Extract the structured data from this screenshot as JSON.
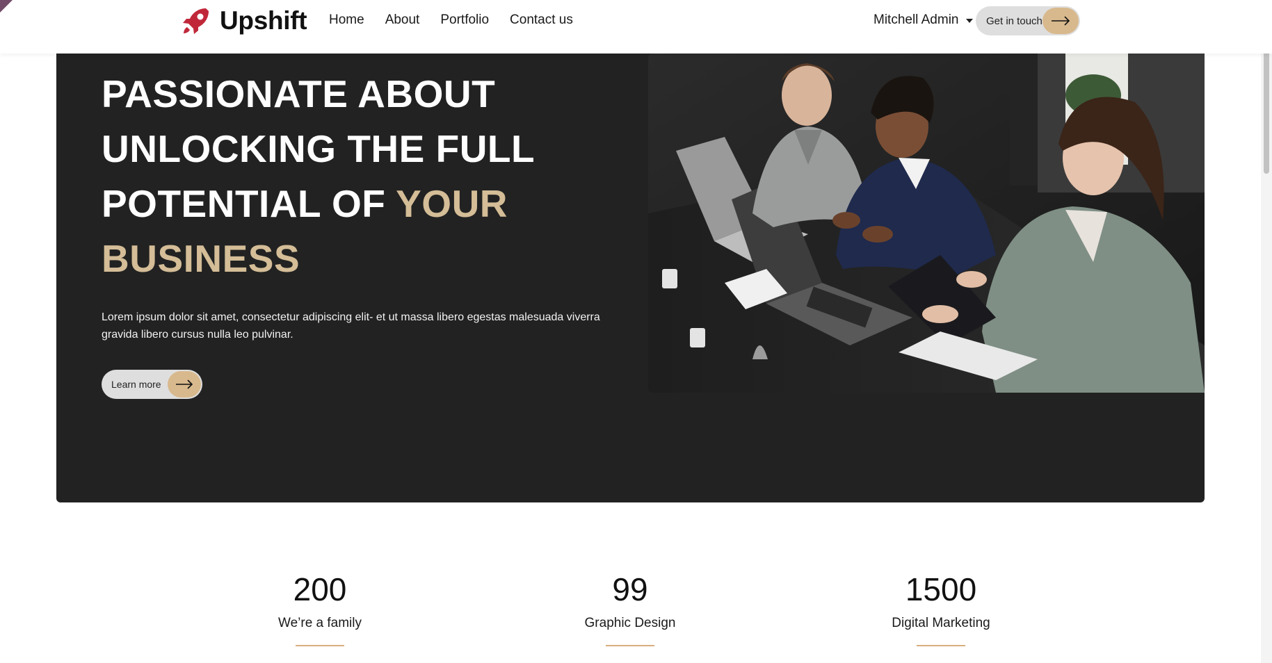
{
  "header": {
    "brand_name": "Upshift",
    "nav": [
      "Home",
      "About",
      "Portfolio",
      "Contact us"
    ],
    "user_name": "Mitchell Admin",
    "cta_label": "Get in touch"
  },
  "hero": {
    "title_line1": "PASSIONATE ABOUT",
    "title_line2": "UNLOCKING THE FULL",
    "title_line3_white": "POTENTIAL OF",
    "title_line3_accent": "YOUR",
    "title_line4_accent": "BUSINESS",
    "body": "Lorem ipsum dolor sit amet, consectetur adipiscing elit- et ut massa libero egestas malesuada viverra gravida libero cursus nulla leo pulvinar.",
    "button_label": "Learn more",
    "image_subject": "office-meeting-photo"
  },
  "stats": [
    {
      "value": "200",
      "label": "We’re a family"
    },
    {
      "value": "99",
      "label": "Graphic Design"
    },
    {
      "value": "1500",
      "label": "Digital Marketing"
    }
  ],
  "colors": {
    "accent_gold": "#d4bd97",
    "button_arrow_bg": "#d8b98d",
    "hero_bg": "#222222",
    "logo_red": "#c0283a",
    "divider": "#d8ae7e"
  },
  "icons": [
    "rocket-logo-icon",
    "arrow-right-icon",
    "caret-down-icon"
  ]
}
